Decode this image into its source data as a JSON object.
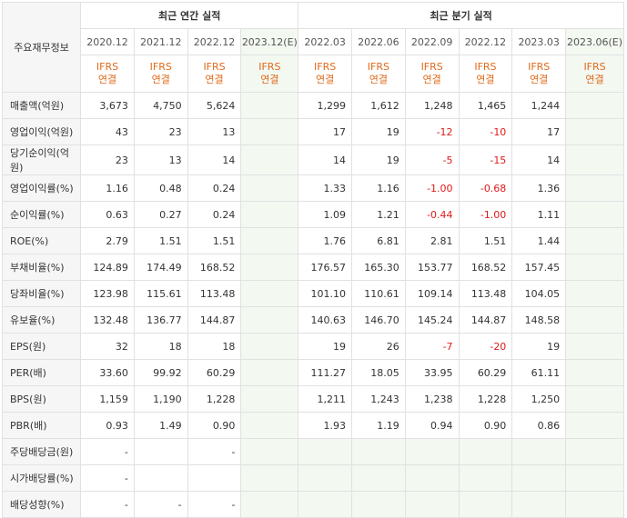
{
  "header": {
    "row_label": "주요재무정보",
    "annual_title": "최근 연간 실적",
    "quarter_title": "최근 분기 실적",
    "periods": [
      "2020.12",
      "2021.12",
      "2022.12",
      "2023.12(E)",
      "2022.03",
      "2022.06",
      "2022.09",
      "2022.12",
      "2023.03",
      "2023.06(E)"
    ],
    "ifrs_line1": "IFRS",
    "ifrs_line2": "연결"
  },
  "rows": [
    {
      "label": "매출액(억원)",
      "values": [
        "3,673",
        "4,750",
        "5,624",
        "",
        "1,299",
        "1,612",
        "1,248",
        "1,465",
        "1,244",
        ""
      ]
    },
    {
      "label": "영업이익(억원)",
      "values": [
        "43",
        "23",
        "13",
        "",
        "17",
        "19",
        "-12",
        "-10",
        "17",
        ""
      ]
    },
    {
      "label": "당기순이익(억원)",
      "values": [
        "23",
        "13",
        "14",
        "",
        "14",
        "19",
        "-5",
        "-15",
        "14",
        ""
      ]
    },
    {
      "label": "영업이익률(%)",
      "values": [
        "1.16",
        "0.48",
        "0.24",
        "",
        "1.33",
        "1.16",
        "-1.00",
        "-0.68",
        "1.36",
        ""
      ]
    },
    {
      "label": "순이익률(%)",
      "values": [
        "0.63",
        "0.27",
        "0.24",
        "",
        "1.09",
        "1.21",
        "-0.44",
        "-1.00",
        "1.11",
        ""
      ]
    },
    {
      "label": "ROE(%)",
      "values": [
        "2.79",
        "1.51",
        "1.51",
        "",
        "1.76",
        "6.81",
        "2.81",
        "1.51",
        "1.44",
        ""
      ]
    },
    {
      "label": "부채비율(%)",
      "values": [
        "124.89",
        "174.49",
        "168.52",
        "",
        "176.57",
        "165.30",
        "153.77",
        "168.52",
        "157.45",
        ""
      ]
    },
    {
      "label": "당좌비율(%)",
      "values": [
        "123.98",
        "115.61",
        "113.48",
        "",
        "101.10",
        "110.61",
        "109.14",
        "113.48",
        "104.05",
        ""
      ]
    },
    {
      "label": "유보율(%)",
      "values": [
        "132.48",
        "136.77",
        "144.87",
        "",
        "140.63",
        "146.70",
        "145.24",
        "144.87",
        "148.58",
        ""
      ]
    },
    {
      "label": "EPS(원)",
      "values": [
        "32",
        "18",
        "18",
        "",
        "19",
        "26",
        "-7",
        "-20",
        "19",
        ""
      ]
    },
    {
      "label": "PER(배)",
      "values": [
        "33.60",
        "99.92",
        "60.29",
        "",
        "111.27",
        "18.05",
        "33.95",
        "60.29",
        "61.11",
        ""
      ]
    },
    {
      "label": "BPS(원)",
      "values": [
        "1,159",
        "1,190",
        "1,228",
        "",
        "1,211",
        "1,243",
        "1,238",
        "1,228",
        "1,250",
        ""
      ]
    },
    {
      "label": "PBR(배)",
      "values": [
        "0.93",
        "1.49",
        "0.90",
        "",
        "1.93",
        "1.19",
        "0.94",
        "0.90",
        "0.86",
        ""
      ]
    },
    {
      "label": "주당배당금(원)",
      "values": [
        "-",
        "",
        "-",
        "",
        "",
        "",
        "",
        "",
        "",
        ""
      ]
    },
    {
      "label": "시가배당률(%)",
      "values": [
        "-",
        "",
        "",
        "",
        "",
        "",
        "",
        "",
        "",
        ""
      ]
    },
    {
      "label": "배당성향(%)",
      "values": [
        "-",
        "-",
        "-",
        "",
        "",
        "",
        "",
        "",
        "",
        ""
      ]
    }
  ]
}
